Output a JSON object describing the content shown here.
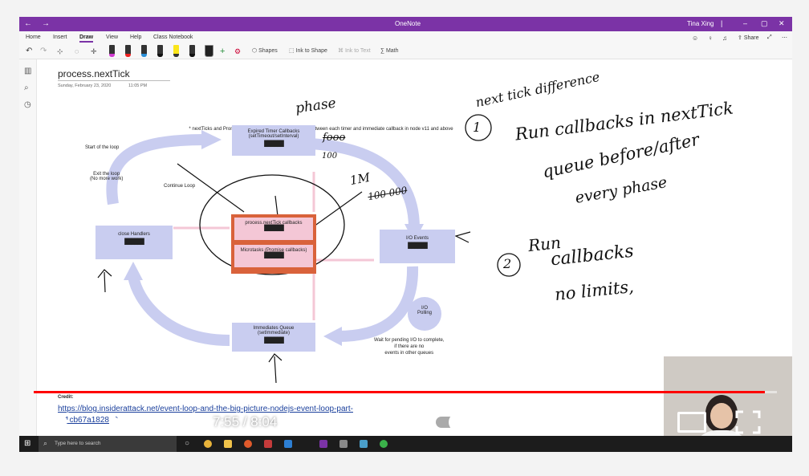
{
  "titlebar": {
    "app_title": "OneNote",
    "user": "Tina Xing"
  },
  "ribbon": {
    "tabs": [
      "Home",
      "Insert",
      "Draw",
      "View",
      "Help",
      "Class Notebook"
    ],
    "active_tab": "Draw",
    "tools": {
      "shapes": "Shapes",
      "ink_to_shape": "Ink to Shape",
      "ink_to_text": "Ink to Text",
      "math": "Math",
      "share": "Share"
    }
  },
  "page": {
    "title": "process.nextTick",
    "date": "Sunday, February 23, 2020",
    "time": "11:05 PM"
  },
  "diagram": {
    "note": "* nextTicks and Promise callback queues are processed between each timer and immediate callback in node v11 and above",
    "start_loop": "Start of the loop",
    "exit_loop": "Exit the loop\n(No more work)",
    "continue_loop": "Continue Loop",
    "timers": {
      "line1": "Expired Timer Callbacks",
      "line2": "(setTimeout/setInterval)"
    },
    "close": "close Handlers",
    "nexttick": "process.nextTick callbacks",
    "microtasks": "Microtasks (Promise callbacks)",
    "io_events": "I/O Events",
    "io_polling": "I/O\nPolling",
    "immediates": {
      "line1": "Immediates Queue",
      "line2": "(setImmediate)"
    },
    "wait_note": "Wait for pending I/O to complete,\nif there are no\nevents in other queues",
    "block": "██████"
  },
  "ink": {
    "phase": "phase",
    "foo": "fooo",
    "foo2": "100",
    "onem": "1M",
    "onem2": "100 000",
    "header": "next tick difference",
    "n1": "1",
    "l1": "Run callbacks in nextTick",
    "l2": "queue before/after",
    "l3": "every phase",
    "n2": "2",
    "l4": "Run",
    "l5": "callbacks",
    "l6": "no limits,"
  },
  "credit": {
    "label": "Credit:",
    "link": "https://blog.insiderattack.net/event-loop-and-the-big-picture-nodejs-event-loop-part-1-1cb67a182810"
  },
  "player": {
    "time": "7:55 / 8:04",
    "progress": 0.984
  },
  "taskbar": {
    "search_placeholder": "Type here to search"
  },
  "colors": {
    "title_bar": "#7b33a6",
    "box_fill": "#c9cdf0",
    "highlight": "#f4c7d6",
    "queue_border": "#d9623b",
    "progress": "#ff0000"
  }
}
